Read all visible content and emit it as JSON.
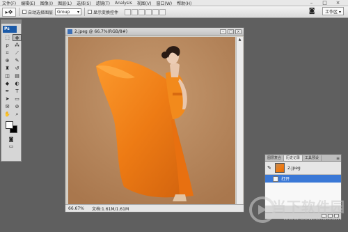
{
  "menubar": {
    "items": [
      "文件(F)",
      "编辑(E)",
      "图像(I)",
      "图层(L)",
      "选择(S)",
      "滤镜(T)",
      "Analysis",
      "视图(V)",
      "窗口(W)",
      "帮助(H)"
    ]
  },
  "window_controls": {
    "minimize": "–",
    "restore": "□",
    "close": "×"
  },
  "options": {
    "tool_preset": "▸✥",
    "auto_select_label": "自动选择图层",
    "auto_select_value": "Group",
    "show_transform_label": "显示变换控件"
  },
  "workspace": {
    "label": "工作区 ▾",
    "icon": "camera-icon"
  },
  "toolbox": {
    "logo": "Ps",
    "tools": [
      {
        "name": "marquee-tool-icon",
        "glyph": "⬚"
      },
      {
        "name": "move-tool-icon",
        "glyph": "✥"
      },
      {
        "name": "lasso-tool-icon",
        "glyph": "ρ"
      },
      {
        "name": "magic-wand-tool-icon",
        "glyph": "⁂"
      },
      {
        "name": "crop-tool-icon",
        "glyph": "⌗"
      },
      {
        "name": "slice-tool-icon",
        "glyph": "⟋"
      },
      {
        "name": "healing-brush-tool-icon",
        "glyph": "⊕"
      },
      {
        "name": "brush-tool-icon",
        "glyph": "✎"
      },
      {
        "name": "clone-stamp-tool-icon",
        "glyph": "♜"
      },
      {
        "name": "history-brush-tool-icon",
        "glyph": "↺"
      },
      {
        "name": "eraser-tool-icon",
        "glyph": "◫"
      },
      {
        "name": "gradient-tool-icon",
        "glyph": "▤"
      },
      {
        "name": "blur-tool-icon",
        "glyph": "◆"
      },
      {
        "name": "dodge-tool-icon",
        "glyph": "◐"
      },
      {
        "name": "pen-tool-icon",
        "glyph": "✒"
      },
      {
        "name": "type-tool-icon",
        "glyph": "T"
      },
      {
        "name": "path-select-tool-icon",
        "glyph": "➤"
      },
      {
        "name": "shape-tool-icon",
        "glyph": "▭"
      },
      {
        "name": "notes-tool-icon",
        "glyph": "✉"
      },
      {
        "name": "eyedropper-tool-icon",
        "glyph": "⊘"
      },
      {
        "name": "hand-tool-icon",
        "glyph": "✋"
      },
      {
        "name": "zoom-tool-icon",
        "glyph": "⌕"
      }
    ],
    "quick_mask_glyph": "◙",
    "screen_mode_glyph": "▭"
  },
  "document": {
    "title": "2.jpeg @ 66.7%(RGB/8#)",
    "zoom": "66.67%",
    "doc_info": "文档:1.61M/1.61M"
  },
  "history_panel": {
    "tabs": [
      "图层复合",
      "历史记录",
      "工具预设"
    ],
    "active_tab": 1,
    "menu_glyph": "≡",
    "snapshot_label": "2.jpeg",
    "states": [
      "打开"
    ]
  },
  "watermark": {
    "text": "当下软件园",
    "url": "www.downxia.com"
  },
  "colors": {
    "workspace_bg": "#5f5f5f",
    "selection_blue": "#3a78d6",
    "photo_backdrop": "#b98a5f",
    "dress_orange": "#f07a10"
  }
}
